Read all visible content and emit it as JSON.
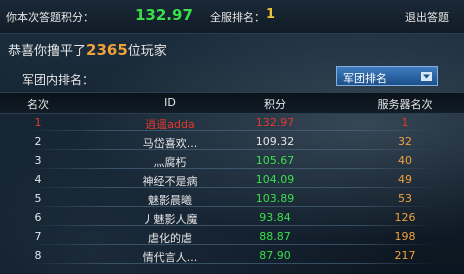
{
  "header": {
    "score_label": "你本次答题积分：",
    "score_value": "132.97",
    "rank_label": "全服排名：",
    "rank_value": "1",
    "exit_label": "退出答题"
  },
  "congrats": {
    "prefix": "恭喜你撸平了",
    "count": "2365",
    "suffix": "位玩家"
  },
  "legion": {
    "label": "军团内排名：",
    "dropdown_value": "军团排名"
  },
  "table": {
    "columns": [
      "名次",
      "ID",
      "积分",
      "服务器名次"
    ],
    "rows": [
      {
        "rank": "1",
        "id": "逍遥adda",
        "score": "132.97",
        "server_rank": "1",
        "score_color": "#e53a2a"
      },
      {
        "rank": "2",
        "id": "马岱喜欢...",
        "score": "109.32",
        "server_rank": "32",
        "score_color": "#e6e6e6"
      },
      {
        "rank": "3",
        "id": "灬腐朽",
        "score": "105.67",
        "server_rank": "40",
        "score_color": "#39e04a"
      },
      {
        "rank": "4",
        "id": "神经不是病",
        "score": "104.09",
        "server_rank": "49",
        "score_color": "#39e04a"
      },
      {
        "rank": "5",
        "id": "魅影晨曦",
        "score": "103.89",
        "server_rank": "53",
        "score_color": "#39e04a"
      },
      {
        "rank": "6",
        "id": "丿魅影人魔",
        "score": "93.84",
        "server_rank": "126",
        "score_color": "#39e04a"
      },
      {
        "rank": "7",
        "id": "虐化的虐",
        "score": "88.87",
        "server_rank": "198",
        "score_color": "#39e04a"
      },
      {
        "rank": "8",
        "id": "情代言人...",
        "score": "87.90",
        "server_rank": "217",
        "score_color": "#39e04a"
      }
    ]
  },
  "icons": {
    "dropdown": "chevron-down-icon"
  }
}
